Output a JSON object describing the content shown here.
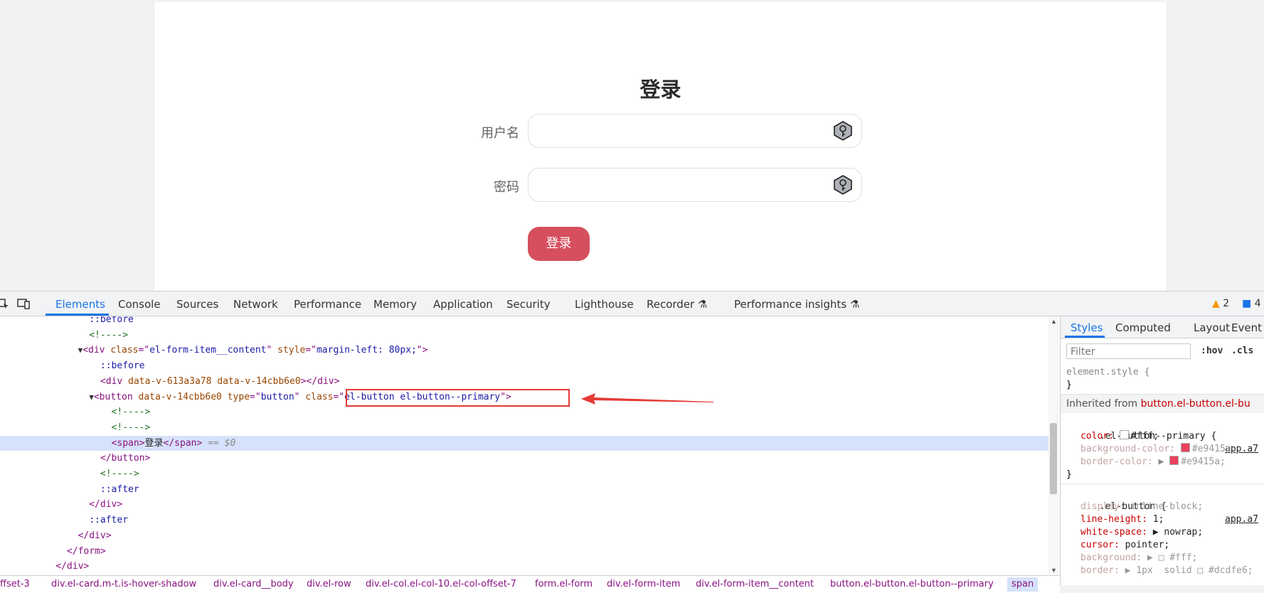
{
  "login": {
    "title": "登录",
    "username_label": "用户名",
    "password_label": "密码",
    "username_value": "",
    "password_value": "",
    "submit_label": "登录"
  },
  "devtools": {
    "tabs": [
      "Elements",
      "Console",
      "Sources",
      "Network",
      "Performance",
      "Memory",
      "Application",
      "Security",
      "Lighthouse",
      "Recorder",
      "Performance insights"
    ],
    "active_tab": "Elements",
    "warnings_count": "2",
    "messages_count": "4",
    "code_lines": [
      {
        "indent": "                ",
        "html": "<span class=\"ps\">::before</span>"
      },
      {
        "indent": "                ",
        "html": "<span class=\"cm\">&lt;!----&gt;</span>"
      },
      {
        "indent": "              ",
        "html": "<span class=\"tri\">▼</span><span class=\"tag\">&lt;div </span><span class=\"attr\">class</span><span class=\"tag\">=\"</span><span class=\"val\">el-form-item__content</span><span class=\"tag\">\" </span><span class=\"attr\">style</span><span class=\"tag\">=\"</span><span class=\"val\">margin-left: 80px;</span><span class=\"tag\">\"&gt;</span>"
      },
      {
        "indent": "                  ",
        "html": "<span class=\"ps\">::before</span>"
      },
      {
        "indent": "                  ",
        "html": "<span class=\"tag\">&lt;div </span><span class=\"attr\">data-v-613a3a78 data-v-14cbb6e0</span><span class=\"tag\">&gt;&lt;/div&gt;</span>"
      },
      {
        "indent": "                ",
        "html": "<span class=\"tri\">▼</span><span class=\"tag\">&lt;button </span><span class=\"attr\">data-v-14cbb6e0 type</span><span class=\"tag\">=\"</span><span class=\"val\">button</span><span class=\"tag\">\" </span><span class=\"attr\">class</span><span class=\"tag\">=\"</span><span class=\"val\">el-button el-button--primary</span><span class=\"tag\">\"&gt;</span>"
      },
      {
        "indent": "                    ",
        "html": "<span class=\"cm\">&lt;!----&gt;</span>"
      },
      {
        "indent": "                    ",
        "html": "<span class=\"cm\">&lt;!----&gt;</span>"
      },
      {
        "indent": "                    ",
        "html": "<span class=\"tag\">&lt;span&gt;</span><span class=\"tx\">登录</span><span class=\"tag\">&lt;/span&gt;</span><span class=\"dim\"> == $0</span>"
      },
      {
        "indent": "                  ",
        "html": "<span class=\"tag\">&lt;/button&gt;</span>"
      },
      {
        "indent": "                  ",
        "html": "<span class=\"cm\">&lt;!----&gt;</span>"
      },
      {
        "indent": "                  ",
        "html": "<span class=\"ps\">::after</span>"
      },
      {
        "indent": "                ",
        "html": "<span class=\"tag\">&lt;/div&gt;</span>"
      },
      {
        "indent": "                ",
        "html": "<span class=\"ps\">::after</span>"
      },
      {
        "indent": "              ",
        "html": "<span class=\"tag\">&lt;/div&gt;</span>"
      },
      {
        "indent": "            ",
        "html": "<span class=\"tag\">&lt;/form&gt;</span>"
      },
      {
        "indent": "          ",
        "html": "<span class=\"tag\">&lt;/div&gt;</span>"
      }
    ],
    "selected_line": 8,
    "breadcrumbs": [
      "ffset-3",
      "div.el-card.m-t.is-hover-shadow",
      "div.el-card__body",
      "div.el-row",
      "div.el-col.el-col-10.el-col-offset-7",
      "form.el-form",
      "div.el-form-item",
      "div.el-form-item__content",
      "button.el-button.el-button--primary",
      "span"
    ],
    "styles_panel": {
      "tabs": [
        "Styles",
        "Computed",
        "Layout",
        "Event L"
      ],
      "active_tab": "Styles",
      "filter_placeholder": "Filter",
      "hov": ":hov",
      "cls": ".cls",
      "element_style": "element.style {",
      "close_brace": "}",
      "inherited_label": "Inherited from",
      "inherited_from": "button.el-button.el-bu",
      "rule1_selector": ".el-button--primary {",
      "rule1_source": "app.a7",
      "rule1_props": [
        {
          "name": "color",
          "value": "#fff",
          "swatch": "#ffffff",
          "disabled": false
        },
        {
          "name": "background-color",
          "value": "#e9415a",
          "swatch": "#e9415a",
          "disabled": true
        },
        {
          "name": "border-color",
          "value": "#e9415a",
          "swatch": "#e9415a",
          "disabled": true,
          "expander": true
        }
      ],
      "rule2_selector": ".el-button {",
      "rule2_source": "app.a7",
      "rule2_props": [
        {
          "name": "display",
          "value": "inline-block;",
          "disabled": true
        },
        {
          "name": "line-height",
          "value": "1;",
          "disabled": false
        },
        {
          "name": "white-space",
          "value": "▶ nowrap;",
          "disabled": false
        },
        {
          "name": "cursor",
          "value": "pointer;",
          "disabled": false
        },
        {
          "name": "background",
          "value": "▶ □ #fff;",
          "disabled": true
        },
        {
          "name": "border",
          "value": "▶ 1px  solid □ #dcdfe6;",
          "disabled": true
        }
      ]
    }
  },
  "colors": {
    "primary_button": "#d64f5e",
    "devtools_accent": "#1a73e8",
    "annotation_red": "#e53935"
  }
}
